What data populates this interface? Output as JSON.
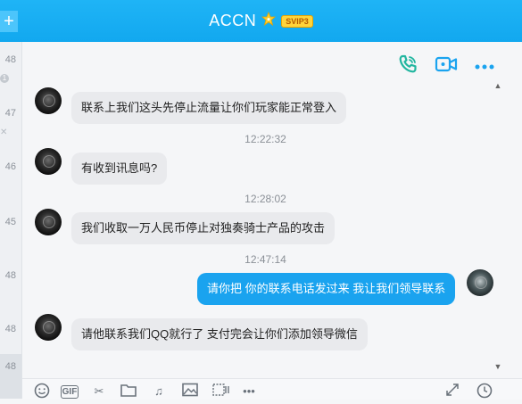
{
  "header": {
    "title": "ACCN",
    "vip_label": "SVIP3",
    "add_symbol": "+"
  },
  "left_strip": {
    "times": [
      "48",
      "47",
      "46",
      "45",
      "48",
      "48",
      "48"
    ],
    "badge_count": "1"
  },
  "actions": {
    "voice_call_icon": "phone-icon",
    "video_call_icon": "video-icon",
    "more_icon": "more-icon",
    "accent": "#22b6a0",
    "blue": "#1aa3ef"
  },
  "messages": [
    {
      "from": "other",
      "text": "联系上我们这头先停止流量让你们玩家能正常登入"
    },
    {
      "timestamp": "12:22:32"
    },
    {
      "from": "other",
      "text": "有收到讯息吗?"
    },
    {
      "timestamp": "12:28:02"
    },
    {
      "from": "other",
      "text": "我们收取一万人民币停止对独奏骑士产品的攻击"
    },
    {
      "timestamp": "12:47:14"
    },
    {
      "from": "me",
      "text": "请你把 你的联系电话发过来 我让我们领导联系"
    },
    {
      "from": "other",
      "text": "请他联系我们QQ就行了 支付完会让你们添加领导微信"
    }
  ],
  "toolbar": {
    "gif_label": "GIF",
    "icons": [
      "emoji-icon",
      "gif-icon",
      "scissors-icon",
      "folder-icon",
      "music-icon",
      "image-icon",
      "screenshot-icon",
      "more-icon",
      "expand-icon",
      "history-icon"
    ]
  }
}
